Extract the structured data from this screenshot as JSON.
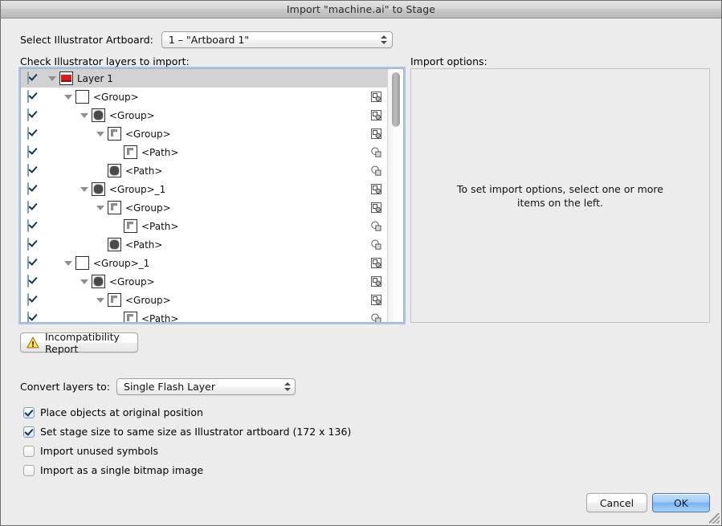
{
  "window": {
    "title": "Import \"machine.ai\" to Stage"
  },
  "artboard": {
    "label": "Select Illustrator Artboard:",
    "selected": "1 – \"Artboard 1\""
  },
  "layers": {
    "label": "Check Illustrator layers to import:",
    "rows": [
      {
        "name": "Layer 1",
        "depth": 0,
        "checked": true,
        "disclosure": "open",
        "thumb": "red",
        "kind": "",
        "selected": true
      },
      {
        "name": "<Group>",
        "depth": 1,
        "checked": true,
        "disclosure": "open",
        "thumb": "blank",
        "kind": "group",
        "selected": false
      },
      {
        "name": "<Group>",
        "depth": 2,
        "checked": true,
        "disclosure": "open",
        "thumb": "blob",
        "kind": "group",
        "selected": false
      },
      {
        "name": "<Group>",
        "depth": 3,
        "checked": true,
        "disclosure": "open",
        "thumb": "corner",
        "kind": "group",
        "selected": false
      },
      {
        "name": "<Path>",
        "depth": 4,
        "checked": true,
        "disclosure": "",
        "thumb": "corner",
        "kind": "path",
        "selected": false
      },
      {
        "name": "<Path>",
        "depth": 3,
        "checked": true,
        "disclosure": "",
        "thumb": "blob",
        "kind": "path",
        "selected": false
      },
      {
        "name": "<Group>_1",
        "depth": 2,
        "checked": true,
        "disclosure": "open",
        "thumb": "blob",
        "kind": "group",
        "selected": false
      },
      {
        "name": "<Group>",
        "depth": 3,
        "checked": true,
        "disclosure": "open",
        "thumb": "corner",
        "kind": "group",
        "selected": false
      },
      {
        "name": "<Path>",
        "depth": 4,
        "checked": true,
        "disclosure": "",
        "thumb": "corner",
        "kind": "path",
        "selected": false
      },
      {
        "name": "<Path>",
        "depth": 3,
        "checked": true,
        "disclosure": "",
        "thumb": "blob",
        "kind": "path",
        "selected": false
      },
      {
        "name": "<Group>_1",
        "depth": 1,
        "checked": true,
        "disclosure": "open",
        "thumb": "blank",
        "kind": "group",
        "selected": false
      },
      {
        "name": "<Group>",
        "depth": 2,
        "checked": true,
        "disclosure": "open",
        "thumb": "blob",
        "kind": "group",
        "selected": false
      },
      {
        "name": "<Group>",
        "depth": 3,
        "checked": true,
        "disclosure": "open",
        "thumb": "corner",
        "kind": "group",
        "selected": false
      },
      {
        "name": "<Path>",
        "depth": 4,
        "checked": true,
        "disclosure": "",
        "thumb": "corner",
        "kind": "path",
        "selected": false
      }
    ]
  },
  "import_options": {
    "label": "Import options:",
    "empty_message": "To set import options, select one or more items on the left."
  },
  "incompatibility": {
    "label": "Incompatibility Report",
    "icon": "warning-triangle-icon"
  },
  "convert": {
    "label": "Convert layers to:",
    "selected": "Single Flash Layer"
  },
  "options": [
    {
      "label": "Place objects at original position",
      "checked": true
    },
    {
      "label": "Set stage size to same size as Illustrator artboard (172 x 136)",
      "checked": true
    },
    {
      "label": "Import unused symbols",
      "checked": false
    },
    {
      "label": "Import as a single bitmap image",
      "checked": false
    }
  ],
  "buttons": {
    "cancel": "Cancel",
    "ok": "OK"
  },
  "colors": {
    "accent": "#78b2ef",
    "focus_ring": "#9bb7d4",
    "warning": "#f2c12c",
    "layer_thumb": "#d81f20"
  }
}
